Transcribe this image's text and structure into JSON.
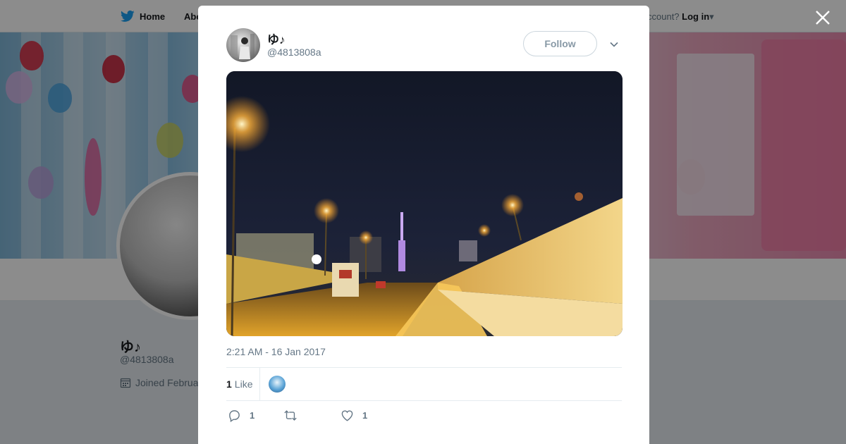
{
  "nav": {
    "home_label": "Home",
    "about_label": "Abo",
    "account_prompt": "ccount?",
    "login_label": "Log in"
  },
  "profile": {
    "name": "ゆ♪",
    "handle": "@4813808a",
    "joined": "Joined Februa"
  },
  "tweet": {
    "author_name": "ゆ♪",
    "author_handle": "@4813808a",
    "follow_label": "Follow",
    "timestamp": "2:21 AM - 16 Jan 2017",
    "like_count": "1",
    "like_label": "Like",
    "reply_count": "1",
    "favorite_count": "1"
  },
  "colors": {
    "brand_blue": "#1da1f2",
    "muted_text": "#657786",
    "border": "#e6ecf0"
  },
  "icons": {
    "home": "twitter-bird-icon",
    "close": "close-icon",
    "caret": "chevron-down-icon",
    "calendar": "calendar-icon",
    "reply": "reply-icon",
    "retweet": "retweet-icon",
    "like": "heart-icon"
  }
}
